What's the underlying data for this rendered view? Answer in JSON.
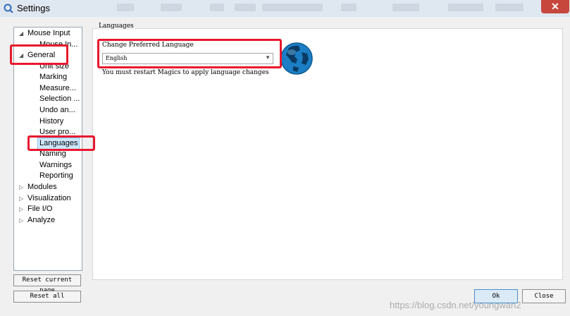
{
  "window": {
    "title": "Settings",
    "close_glyph": "✕"
  },
  "tree": {
    "items": [
      {
        "label": "Mouse Input",
        "arrow": "◢"
      },
      {
        "label": "Mouse In..."
      },
      {
        "label": "General",
        "arrow": "◢"
      },
      {
        "label": "Unit size"
      },
      {
        "label": "Marking"
      },
      {
        "label": "Measure..."
      },
      {
        "label": "Selection ..."
      },
      {
        "label": "Undo an..."
      },
      {
        "label": "History"
      },
      {
        "label": "User pro..."
      },
      {
        "label": "Languages"
      },
      {
        "label": "Naming"
      },
      {
        "label": "Warnings"
      },
      {
        "label": "Reporting"
      },
      {
        "label": "Modules",
        "arrow": "▷"
      },
      {
        "label": "Visualization",
        "arrow": "▷"
      },
      {
        "label": "File I/O",
        "arrow": "▷"
      },
      {
        "label": "Analyze",
        "arrow": "▷"
      }
    ]
  },
  "buttons": {
    "reset_current": "Reset current page",
    "reset_all": "Reset all",
    "ok": "Ok",
    "close": "Close"
  },
  "panel": {
    "group_title": "Languages",
    "change_label": "Change Preferred Language",
    "selected_language": "English",
    "restart_note": "You must restart Magics to apply language changes"
  },
  "watermark": "https://blog.csdn.net/youngwan2"
}
